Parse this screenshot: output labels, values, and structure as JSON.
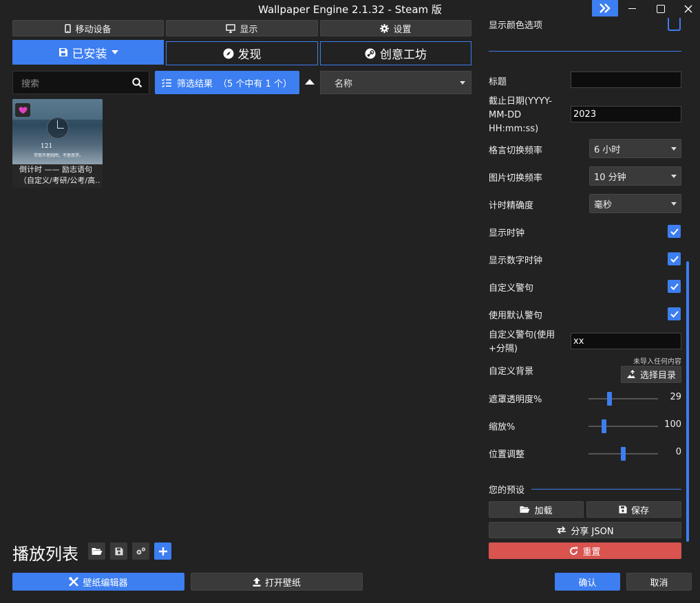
{
  "window": {
    "title": "Wallpaper Engine 2.1.32 - Steam 版"
  },
  "topnav": {
    "mobile": "移动设备",
    "display": "显示",
    "settings": "设置"
  },
  "tabs": {
    "installed": "已安装",
    "discover": "发现",
    "workshop": "创意工坊"
  },
  "search": {
    "placeholder": "搜索"
  },
  "filter": {
    "label": "筛选结果",
    "count": "（5 个中有 1 个）"
  },
  "sort": {
    "value": "名称"
  },
  "card": {
    "clock_text": "121",
    "slogan": "学而不思则罔，不思而学。",
    "caption_line1": "倒计时 —— 励志语句",
    "caption_line2": "（自定义/考研/公考/高…"
  },
  "playlist": {
    "title": "播放列表"
  },
  "bottom": {
    "editor": "壁纸编辑器",
    "open": "打开壁纸",
    "confirm": "确认",
    "cancel": "取消"
  },
  "props": {
    "show_color": "显示颜色选项",
    "title_label": "标题",
    "title_value": "",
    "deadline_label_1": "截止日期(YYYY-",
    "deadline_label_2": "MM-DD",
    "deadline_label_3": "HH:mm:ss)",
    "deadline_value": "2023",
    "quote_freq_label": "格言切换频率",
    "quote_freq_value": "6 小时",
    "image_freq_label": "图片切换频率",
    "image_freq_value": "10 分钟",
    "precision_label": "计时精确度",
    "precision_value": "毫秒",
    "show_clock": "显示时钟",
    "show_digital_clock": "显示数字时钟",
    "custom_quote": "自定义警句",
    "default_quote": "使用默认警句",
    "custom_quote_sep_1": "自定义警句(使用",
    "custom_quote_sep_2": "+分隔)",
    "custom_quote_sep_value": "xx",
    "custom_bg": "自定义背景",
    "no_content": "未导入任何内容",
    "choose_dir": "选择目录",
    "opacity_label": "遮罩透明度%",
    "opacity_value": "29",
    "scale_label": "缩放%",
    "scale_value": "100",
    "position_label": "位置调整",
    "position_value": "0"
  },
  "checks": {
    "show_color": false,
    "show_clock": true,
    "show_digital_clock": true,
    "custom_quote": true,
    "default_quote": true
  },
  "sliders": {
    "opacity_fraction": 0.29,
    "scale_fraction": 0.2,
    "position_fraction": 0.5
  },
  "presets": {
    "title": "您的预设",
    "load": "加载",
    "save": "保存",
    "share": "分享 JSON",
    "reset": "重置"
  },
  "colors": {
    "accent": "#3d7ef0",
    "background": "#222222",
    "danger": "#d9534f",
    "favorite": "#e040c0"
  }
}
